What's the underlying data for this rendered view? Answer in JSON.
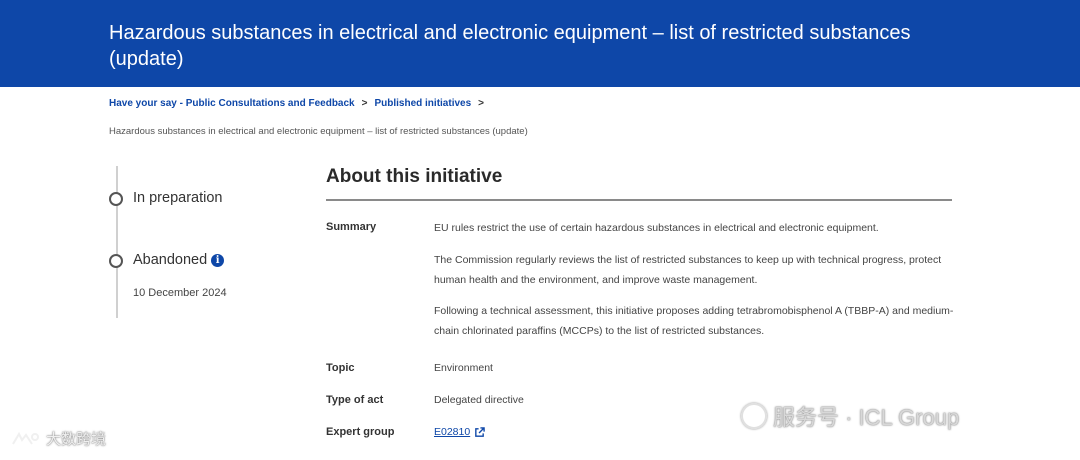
{
  "header": {
    "title": "Hazardous substances in electrical and electronic equipment – list of restricted substances (update)"
  },
  "breadcrumb": {
    "items": [
      "Have your say - Public Consultations and Feedback",
      "Published initiatives"
    ],
    "separator": ">"
  },
  "page_subtitle": "Hazardous substances in electrical and electronic equipment – list of restricted substances (update)",
  "timeline": {
    "stages": [
      {
        "label": "In preparation"
      },
      {
        "label": "Abandoned",
        "info_icon": "info-icon",
        "date": "10 December 2024"
      }
    ]
  },
  "about": {
    "title": "About this initiative",
    "summary_label": "Summary",
    "summary_paragraphs": [
      "EU rules restrict the use of certain hazardous substances in electrical and electronic equipment.",
      "The Commission regularly reviews the list of restricted substances to keep up with technical progress, protect human health and the environment, and improve waste management.",
      "Following a technical assessment, this initiative proposes adding tetrabromobisphenol A (TBBP-A) and medium-chain chlorinated paraffins (MCCPs) to the list of restricted substances."
    ],
    "topic_label": "Topic",
    "topic_value": "Environment",
    "type_label": "Type of act",
    "type_value": "Delegated directive",
    "expert_label": "Expert group",
    "expert_value": "E02810"
  },
  "watermarks": {
    "left": "大数跨境",
    "right": "服务号 · ICL Group"
  },
  "colors": {
    "header_bg": "#0e47a8",
    "link": "#0e47a8"
  }
}
